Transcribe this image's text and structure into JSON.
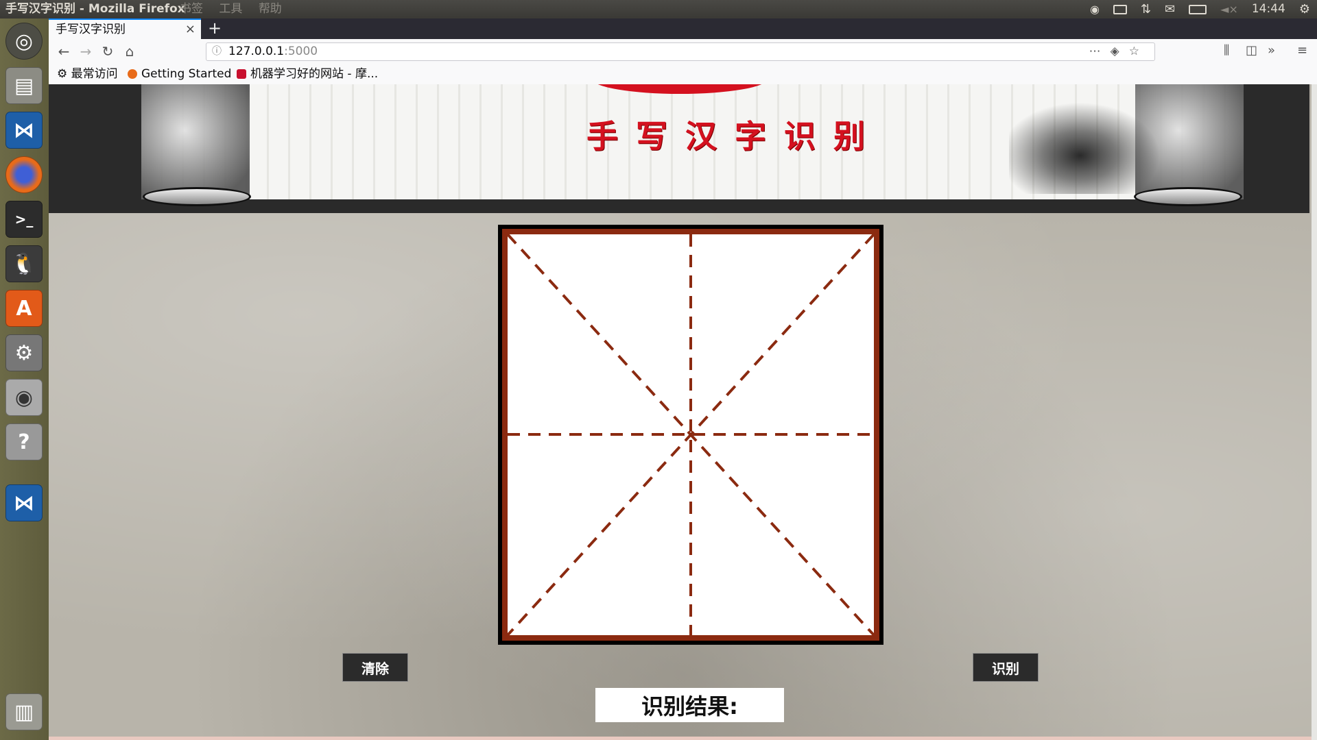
{
  "window": {
    "title": "手写汉字识别 - Mozilla Firefox",
    "menus": [
      "书签",
      "工具",
      "帮助"
    ]
  },
  "system": {
    "clock": "14:44"
  },
  "browser": {
    "tab_title": "手写汉字识别",
    "url_host": "127.0.0.1",
    "url_port": ":5000",
    "bookmarks": [
      "最常访问",
      "Getting Started",
      "机器学习好的网站 - 摩..."
    ]
  },
  "launcher": {
    "items": [
      "ubuntu-dash",
      "files",
      "vscode",
      "firefox",
      "terminal",
      "qq",
      "software-center",
      "system-settings",
      "screenshot",
      "help",
      "vscode",
      "trash"
    ]
  },
  "page": {
    "banner_title": "手写汉字识别",
    "clear_label": "清除",
    "recognize_label": "识别",
    "result_label": "识别结果:"
  },
  "colors": {
    "grid_red": "#8b2a10",
    "title_red": "#d4111f"
  }
}
